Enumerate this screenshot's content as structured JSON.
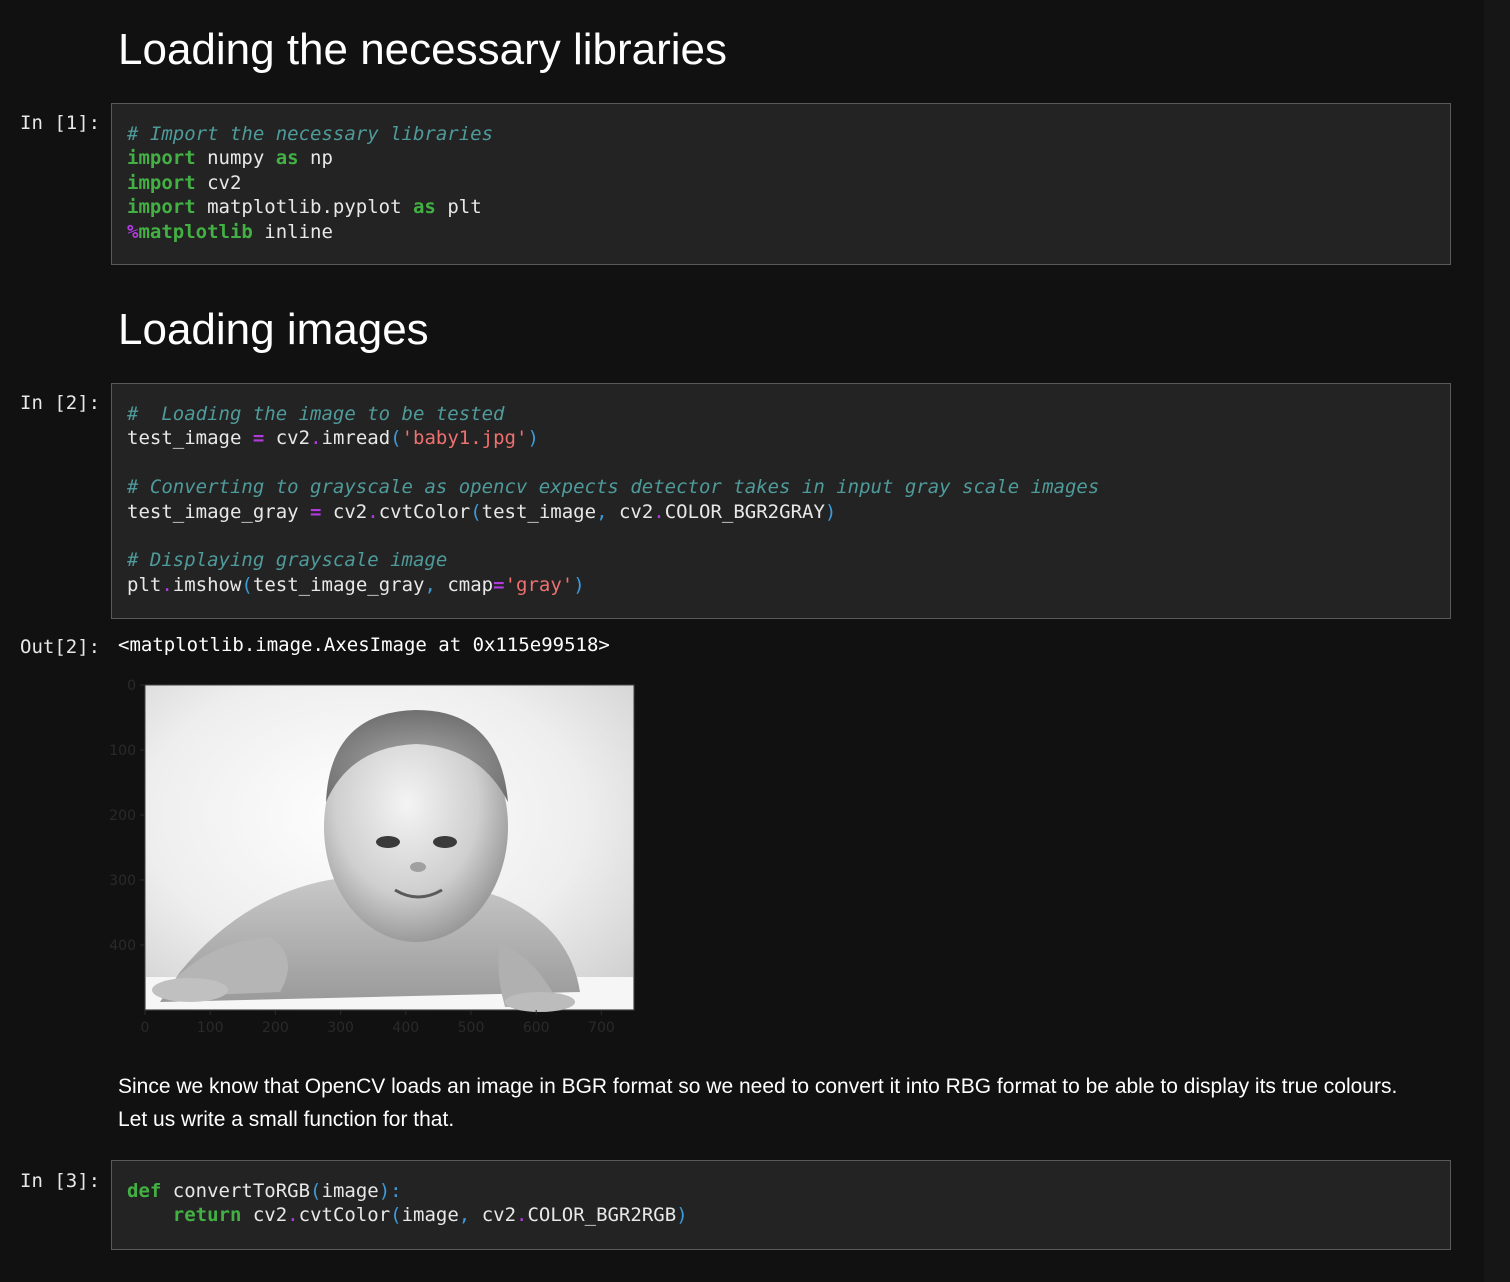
{
  "headings": {
    "libraries": "Loading the necessary libraries",
    "images": "Loading images"
  },
  "cells": {
    "cell1": {
      "prompt": "In [1]:",
      "lines": [
        [
          [
            "comment",
            "# Import the necessary libraries"
          ]
        ],
        [
          [
            "keyword",
            "import"
          ],
          [
            "name",
            " numpy "
          ],
          [
            "keyword",
            "as"
          ],
          [
            "name",
            " np"
          ]
        ],
        [
          [
            "keyword",
            "import"
          ],
          [
            "name",
            " cv2"
          ]
        ],
        [
          [
            "keyword",
            "import"
          ],
          [
            "name",
            " matplotlib.pyplot "
          ],
          [
            "keyword",
            "as"
          ],
          [
            "name",
            " plt"
          ]
        ],
        [
          [
            "magic-pct",
            "%"
          ],
          [
            "magic",
            "matplotlib"
          ],
          [
            "name",
            " inline"
          ]
        ]
      ]
    },
    "cell2": {
      "prompt": "In [2]:",
      "lines": [
        [
          [
            "comment",
            "#  Loading the image to be tested"
          ]
        ],
        [
          [
            "name",
            "test_image "
          ],
          [
            "op",
            "="
          ],
          [
            "name",
            " cv2"
          ],
          [
            "dot",
            "."
          ],
          [
            "name",
            "imread"
          ],
          [
            "paren",
            "("
          ],
          [
            "string",
            "'baby1.jpg'"
          ],
          [
            "paren",
            ")"
          ]
        ],
        [
          [
            "name",
            ""
          ]
        ],
        [
          [
            "comment",
            "# Converting to grayscale as opencv expects detector takes in input gray scale images"
          ]
        ],
        [
          [
            "name",
            "test_image_gray "
          ],
          [
            "op",
            "="
          ],
          [
            "name",
            " cv2"
          ],
          [
            "dot",
            "."
          ],
          [
            "name",
            "cvtColor"
          ],
          [
            "paren",
            "("
          ],
          [
            "name",
            "test_image"
          ],
          [
            "punct",
            ","
          ],
          [
            "name",
            " cv2"
          ],
          [
            "dot",
            "."
          ],
          [
            "name",
            "COLOR_BGR2GRAY"
          ],
          [
            "paren",
            ")"
          ]
        ],
        [
          [
            "name",
            ""
          ]
        ],
        [
          [
            "comment",
            "# Displaying grayscale image"
          ]
        ],
        [
          [
            "name",
            "plt"
          ],
          [
            "dot",
            "."
          ],
          [
            "name",
            "imshow"
          ],
          [
            "paren",
            "("
          ],
          [
            "name",
            "test_image_gray"
          ],
          [
            "punct",
            ","
          ],
          [
            "name",
            " cmap"
          ],
          [
            "op",
            "="
          ],
          [
            "string",
            "'gray'"
          ],
          [
            "paren",
            ")"
          ]
        ]
      ]
    },
    "cell3": {
      "prompt": "In [3]:",
      "lines": [
        [
          [
            "keyword",
            "def"
          ],
          [
            "name",
            " convertToRGB"
          ],
          [
            "paren",
            "("
          ],
          [
            "name",
            "image"
          ],
          [
            "paren",
            ")"
          ],
          [
            "punct",
            ":"
          ]
        ],
        [
          [
            "name",
            "    "
          ],
          [
            "keyword",
            "return"
          ],
          [
            "name",
            " cv2"
          ],
          [
            "dot",
            "."
          ],
          [
            "name",
            "cvtColor"
          ],
          [
            "paren",
            "("
          ],
          [
            "name",
            "image"
          ],
          [
            "punct",
            ","
          ],
          [
            "name",
            " cv2"
          ],
          [
            "dot",
            "."
          ],
          [
            "name",
            "COLOR_BGR2RGB"
          ],
          [
            "paren",
            ")"
          ]
        ]
      ]
    }
  },
  "output2": {
    "prompt": "Out[2]:",
    "text": "<matplotlib.image.AxesImage at 0x115e99518>",
    "image_description": "grayscale photo of a smiling baby lying on its stomach",
    "xticks": [
      "0",
      "100",
      "200",
      "300",
      "400",
      "500",
      "600",
      "700"
    ],
    "yticks": [
      "0",
      "100",
      "200",
      "300",
      "400"
    ]
  },
  "markdown": {
    "para_line1": "Since we know that OpenCV loads an image in BGR format so we need to convert it into RBG format to be able to display its true colours.",
    "para_line2": "Let us write a small function for that."
  },
  "colors": {
    "background": "#111111",
    "cell_bg": "#232323",
    "comment": "#4f9a9a",
    "keyword": "#43b043",
    "operator": "#b23be0",
    "string": "#f07070",
    "paren": "#3d9ad8"
  }
}
